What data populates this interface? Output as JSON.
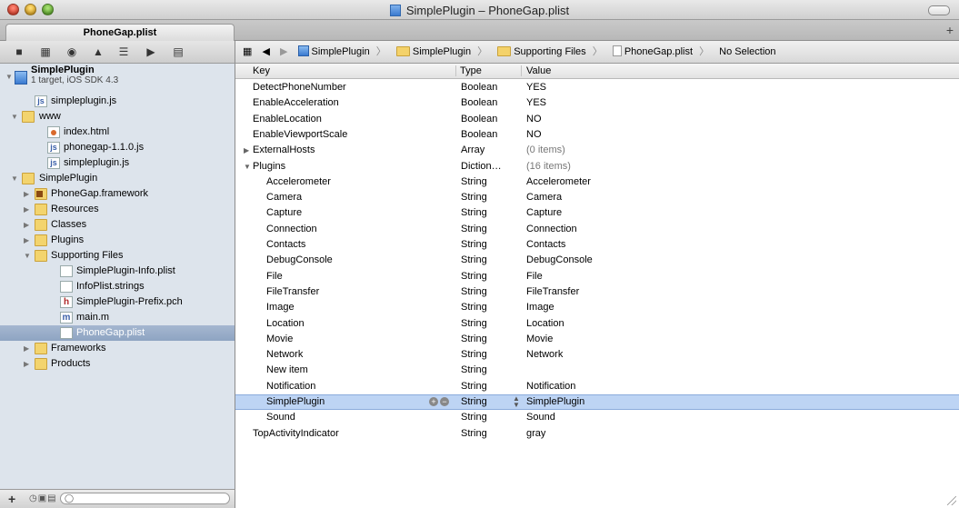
{
  "window": {
    "title": "SimplePlugin – PhoneGap.plist",
    "tab_label": "PhoneGap.plist",
    "tab_add": "+"
  },
  "jumpbar": {
    "items": [
      "SimplePlugin",
      "SimplePlugin",
      "Supporting Files",
      "PhoneGap.plist",
      "No Selection"
    ]
  },
  "navigator": {
    "project_name": "SimplePlugin",
    "project_subtitle": "1 target, iOS SDK 4.3",
    "items": [
      {
        "label": "simpleplugin.js",
        "icon": "js-file-icon"
      },
      {
        "label": "www",
        "icon": "folder-icon"
      },
      {
        "label": "index.html",
        "icon": "html-file-icon"
      },
      {
        "label": "phonegap-1.1.0.js",
        "icon": "js-file-icon"
      },
      {
        "label": "simpleplugin.js",
        "icon": "js-file-icon"
      },
      {
        "label": "SimplePlugin",
        "icon": "folder-icon"
      },
      {
        "label": "PhoneGap.framework",
        "icon": "framework-icon"
      },
      {
        "label": "Resources",
        "icon": "folder-icon"
      },
      {
        "label": "Classes",
        "icon": "folder-icon"
      },
      {
        "label": "Plugins",
        "icon": "folder-icon"
      },
      {
        "label": "Supporting Files",
        "icon": "folder-icon"
      },
      {
        "label": "SimplePlugin-Info.plist",
        "icon": "plist-file-icon"
      },
      {
        "label": "InfoPlist.strings",
        "icon": "strings-file-icon"
      },
      {
        "label": "SimplePlugin-Prefix.pch",
        "icon": "header-file-icon"
      },
      {
        "label": "main.m",
        "icon": "m-file-icon"
      },
      {
        "label": "PhoneGap.plist",
        "icon": "plist-file-icon"
      },
      {
        "label": "Frameworks",
        "icon": "folder-icon"
      },
      {
        "label": "Products",
        "icon": "folder-icon"
      }
    ],
    "bottom_add": "+"
  },
  "plist": {
    "columns": {
      "key": "Key",
      "type": "Type",
      "value": "Value"
    },
    "rows": [
      {
        "key": "DetectPhoneNumber",
        "type": "Boolean",
        "value": "YES"
      },
      {
        "key": "EnableAcceleration",
        "type": "Boolean",
        "value": "YES"
      },
      {
        "key": "EnableLocation",
        "type": "Boolean",
        "value": "NO"
      },
      {
        "key": "EnableViewportScale",
        "type": "Boolean",
        "value": "NO"
      },
      {
        "key": "ExternalHosts",
        "type": "Array",
        "value": "(0 items)"
      },
      {
        "key": "Plugins",
        "type": "Diction…",
        "value": "(16 items)"
      },
      {
        "key": "Accelerometer",
        "type": "String",
        "value": "Accelerometer"
      },
      {
        "key": "Camera",
        "type": "String",
        "value": "Camera"
      },
      {
        "key": "Capture",
        "type": "String",
        "value": "Capture"
      },
      {
        "key": "Connection",
        "type": "String",
        "value": "Connection"
      },
      {
        "key": "Contacts",
        "type": "String",
        "value": "Contacts"
      },
      {
        "key": "DebugConsole",
        "type": "String",
        "value": "DebugConsole"
      },
      {
        "key": "File",
        "type": "String",
        "value": "File"
      },
      {
        "key": "FileTransfer",
        "type": "String",
        "value": "FileTransfer"
      },
      {
        "key": "Image",
        "type": "String",
        "value": "Image"
      },
      {
        "key": "Location",
        "type": "String",
        "value": "Location"
      },
      {
        "key": "Movie",
        "type": "String",
        "value": "Movie"
      },
      {
        "key": "Network",
        "type": "String",
        "value": "Network"
      },
      {
        "key": "New item",
        "type": "String",
        "value": ""
      },
      {
        "key": "Notification",
        "type": "String",
        "value": "Notification"
      },
      {
        "key": "SimplePlugin",
        "type": "String",
        "value": "SimplePlugin"
      },
      {
        "key": "Sound",
        "type": "String",
        "value": "Sound"
      },
      {
        "key": "TopActivityIndicator",
        "type": "String",
        "value": "gray"
      }
    ]
  },
  "colors": {
    "selection": "#bdd4f4",
    "sidebar_bg": "#dde4ec",
    "sidebar_selection": "#8ea4c2"
  }
}
